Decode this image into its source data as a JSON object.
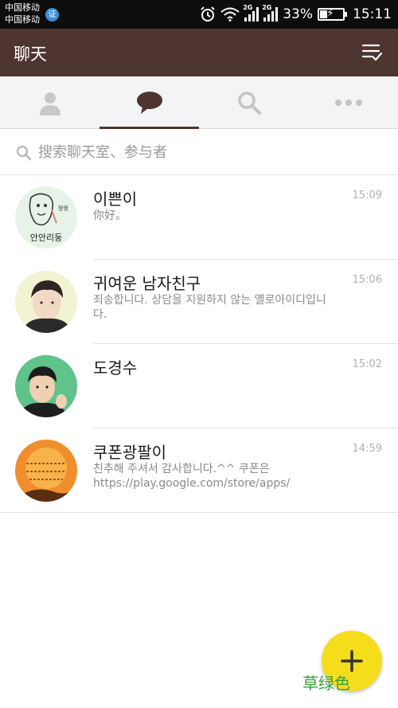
{
  "status_bar": {
    "carrier_line1": "中国移动",
    "carrier_line2": "中国移动",
    "carrier_badge": "证",
    "network_1": "2G",
    "network_2": "2G",
    "battery": "33%",
    "time": "15:11",
    "icons": [
      "alarm-icon",
      "wifi-icon",
      "signal-icon",
      "battery-charging-icon"
    ]
  },
  "app_bar": {
    "title": "聊天",
    "menu_icon": "menu-check-icon"
  },
  "tabs": [
    {
      "name": "friends",
      "icon": "person-icon",
      "active": false
    },
    {
      "name": "chats",
      "icon": "chat-bubble-icon",
      "active": true
    },
    {
      "name": "search",
      "icon": "search-icon",
      "active": false
    },
    {
      "name": "more",
      "icon": "more-dots-icon",
      "active": false
    }
  ],
  "search": {
    "placeholder": "搜索聊天室、参与者",
    "value": ""
  },
  "chats": [
    {
      "name": "이쁜이",
      "time": "15:09",
      "message": "你好。",
      "avatar_text": "안안리둥"
    },
    {
      "name": "귀여운 남자친구",
      "time": "15:06",
      "message": "죄송합니다. 상담을 지원하지 않는 옐로아이디입니다."
    },
    {
      "name": "도경수",
      "time": "15:02",
      "message": ""
    },
    {
      "name": "쿠폰광팔이",
      "time": "14:59",
      "message": "친추해 주셔서 감사합니다.^^ 쿠폰은 https://play.google.com/store/apps/"
    }
  ],
  "fab": {
    "icon": "plus-icon",
    "label": "草绿色"
  },
  "colors": {
    "app_bar": "#4e3530",
    "fab": "#f5dd1c",
    "tab_bg": "#f4f4f4"
  }
}
